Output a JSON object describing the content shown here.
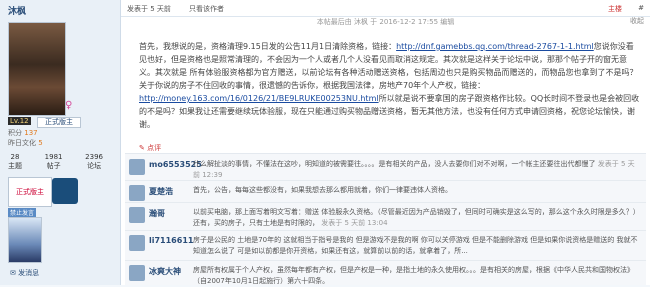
{
  "user": {
    "name": "沐枫",
    "level": "Lv.12",
    "title": "正式版主",
    "stats": [
      {
        "label": "积分",
        "value": "137"
      },
      {
        "label": "昨日文化",
        "value": "5"
      }
    ],
    "counts": [
      {
        "value": "28",
        "label": "主题"
      },
      {
        "value": "1981",
        "label": "帖子"
      },
      {
        "value": "2396",
        "label": "论坛"
      }
    ],
    "medal_label": "正式版主",
    "banned_label": "禁止发言",
    "send_message": "发消息"
  },
  "post": {
    "author_tag": "发表于 5 天前",
    "only_author": "只看该作者",
    "floor": "主楼",
    "floor_hash": "#",
    "collapse": "收起",
    "meta": "本帖最后由 沐枫 于 2016-12-2 17:55 编辑",
    "body_1": "首先，我想说的是，资格清理9.15日发的公告11月1日清除资格，链接：",
    "link_1": "http://dnf.gamebbs.qq.com/thread-2767-1-1.html",
    "body_2": "您说你没看见也好，但是资格也是照常清理的，不会因为一个人或者几个人没看见而取消这规定。其次就是这样关于论坛中说，那那个帖子开的窗无意义。其次就是 所有体验服资格都为官方赠送，以前论坛有各种活动赠送资格，包括周边也只是购买物品而赠送的，而物品您也拿到了不是吗？关于你说的房子不住回收的事情，很遗憾的告诉你，根据我国法律，房地产70年个人产权，链接：",
    "link_2": "http://money.163.com/16/0126/21/BE9LRUKE00253NU.html",
    "body_3": "所以就是说不要拿国的房子跟资格作比较。QQ长时间不登录也是会被回收的不是吗？如果我让还需要继续玩体验服，现在只能通过购买物品赠送资格，暂无其他方法，也没有任何方式申请回资格，祝您论坛愉快，谢谢。",
    "vote": "点评"
  },
  "comments": [
    {
      "name": "mo6553525",
      "text": "什么解扯淡的事情，不懂法在这吵，明知道的被需要往。。。。是有相关的产品，没人去要你们对不对啊，一个帐主还要往出代都慢了",
      "time": "发表于 5 天前 12:39"
    },
    {
      "name": "夏楚浩",
      "text": "首先，公告，每每这些都没有，如果我想去那么都用就着，你们一律要违体人资格。",
      "time": ""
    },
    {
      "name": "瀚哥",
      "text": "以前买电脑，那上面写着明文写着：赠送 体验服永久资格。（尽管最近因为产品销毁了，但同时可确实是这么写的，那么这个永久时限是多久？）还有，买的房子，只有土地是有时限的，",
      "time": "发表于 5 天前 13:04"
    },
    {
      "name": "li7116611",
      "text": "房子是公民的 土地是70年的 这就相当于指号是我的 但是游戏不是我的啊 你可以关停游戏 但是不能删除游戏 但是如果你说资格是赠送的 我就不知道怎么说了 可是如以前都是你开资格，如果还有这，就算前以前的话，就拿着了，所... ",
      "time": ""
    },
    {
      "name": "冰爽大神",
      "text": "房屋所有权属于个人产权，虽然每年都有产权，但是产权是一种，是指土地的永久使用权。。。是有相关的房屋，根据《中华人民共和国物权法》（自2007年10月1日起施行）第六十四条。",
      "time": ""
    }
  ]
}
